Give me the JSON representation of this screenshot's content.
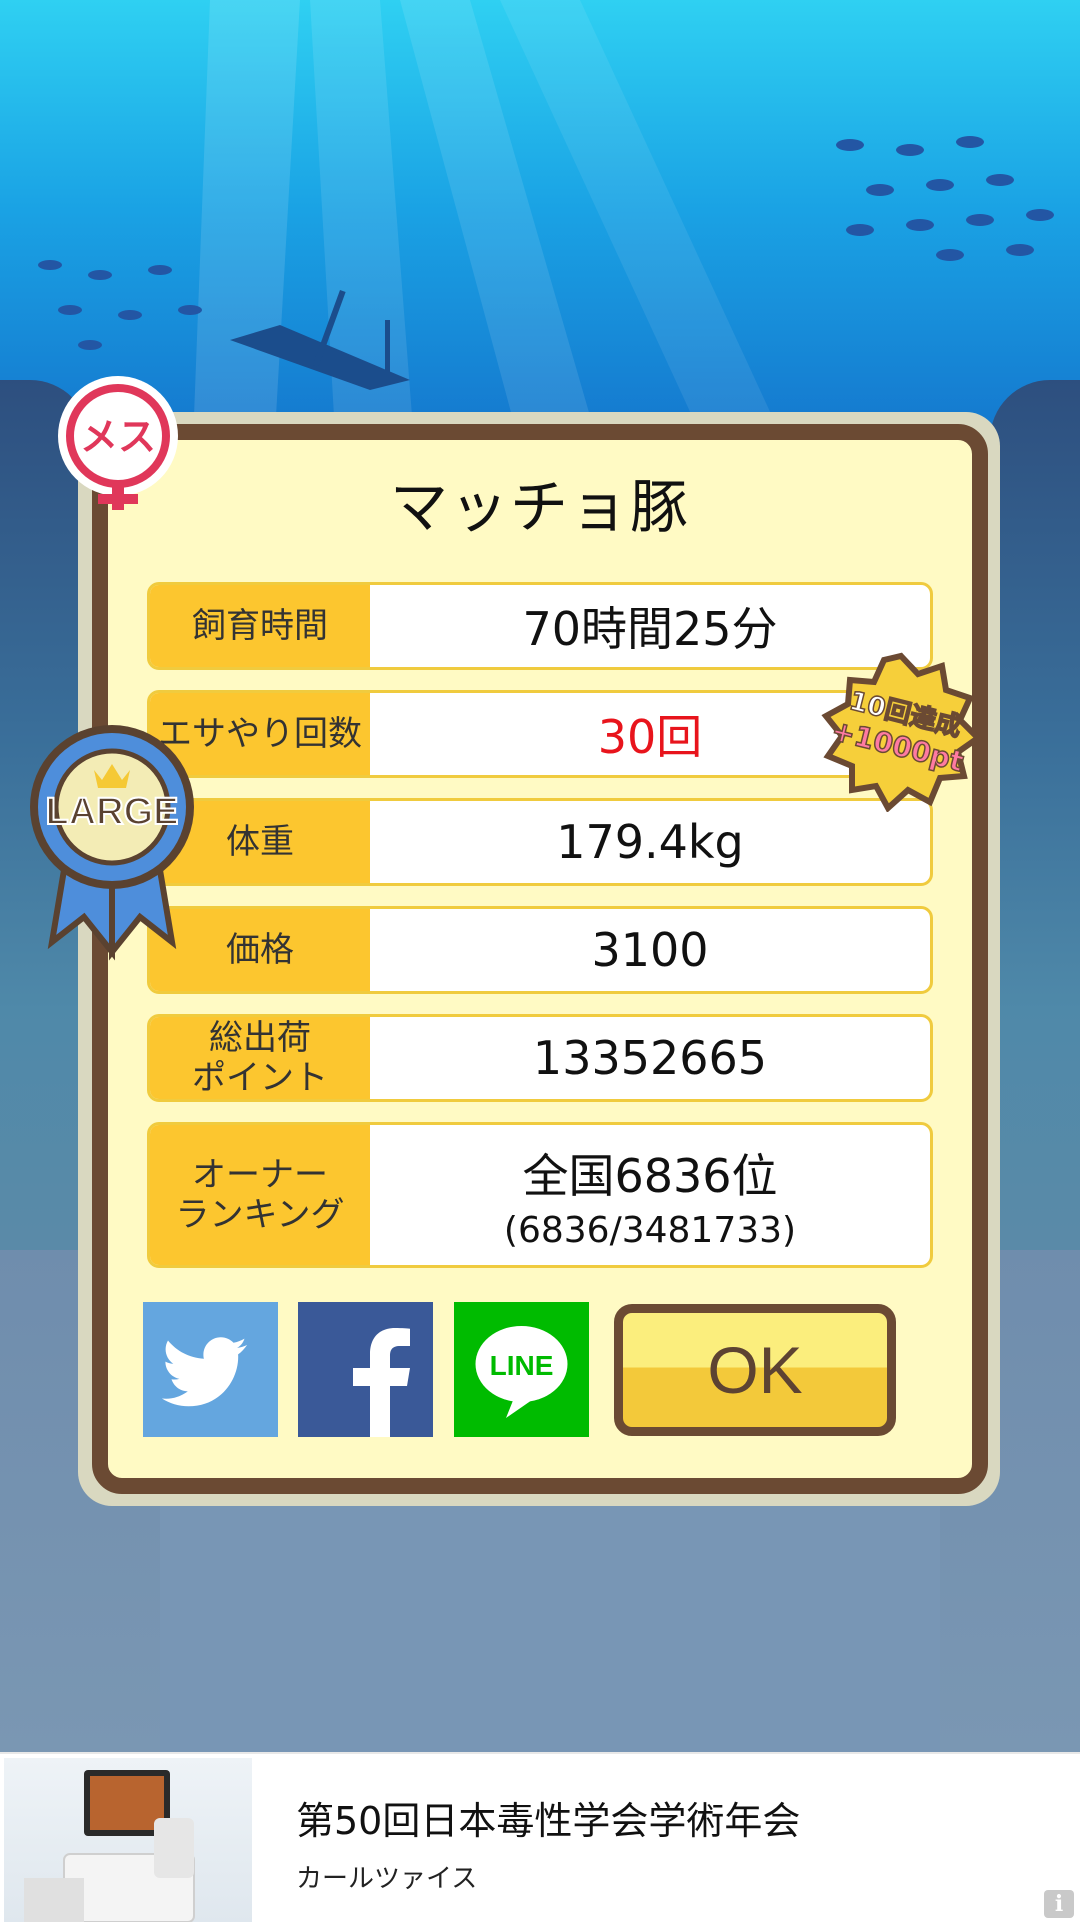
{
  "dialog": {
    "title": "マッチョ豚",
    "rows": [
      {
        "label": "飼育時間",
        "value": "70時間25分"
      },
      {
        "label": "エサやり回数",
        "value": "30回"
      },
      {
        "label": "体重",
        "value": "179.4kg"
      },
      {
        "label": "価格",
        "value": "3100"
      },
      {
        "label": "総出荷\nポイント",
        "value": "13352665"
      },
      {
        "label": "オーナー\nランキング",
        "value": "全国6836位",
        "sub_value": "(6836/3481733)"
      }
    ]
  },
  "badges": {
    "gender": "メス",
    "size": "LARGE",
    "achievement_line1": "10回達成",
    "achievement_line2": "+1000pt"
  },
  "buttons": {
    "twitter_icon": "twitter-bird-icon",
    "facebook_icon": "facebook-f-icon",
    "line_label": "LINE",
    "ok_label": "OK"
  },
  "ad": {
    "title": "第50回日本毒性学会学術年会",
    "advertiser": "カールツァイス",
    "info_glyph": "i"
  },
  "colors": {
    "label_bg": "#fcc62f",
    "modal_bg": "#fffac4",
    "modal_border": "#6b4a33",
    "highlight_red": "#e8141c",
    "twitter": "#64a6df",
    "facebook": "#3a5998",
    "line": "#00bb00"
  }
}
